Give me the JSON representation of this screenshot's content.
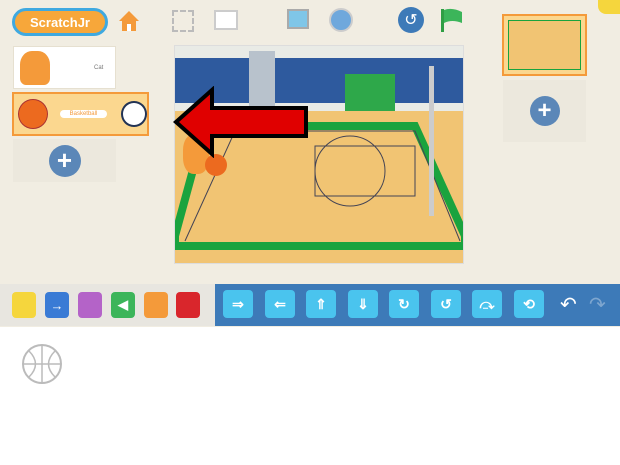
{
  "app": {
    "logo": "ScratchJr"
  },
  "sprites": [
    {
      "name": "Cat",
      "selected": false
    },
    {
      "name": "Basketball",
      "selected": true
    }
  ],
  "categories": [
    {
      "name": "triggering",
      "color": "#f5d63d"
    },
    {
      "name": "motion",
      "color": "#3a7bd5"
    },
    {
      "name": "looks",
      "color": "#b463c8"
    },
    {
      "name": "sound",
      "color": "#3cb55a"
    },
    {
      "name": "control",
      "color": "#f49a3a"
    },
    {
      "name": "end",
      "color": "#d9262c"
    }
  ],
  "blocks": [
    {
      "name": "move-right",
      "glyph": "⇒"
    },
    {
      "name": "move-left",
      "glyph": "⇐"
    },
    {
      "name": "move-up",
      "glyph": "⇑"
    },
    {
      "name": "move-down",
      "glyph": "⇓"
    },
    {
      "name": "turn-right",
      "glyph": "↻"
    },
    {
      "name": "turn-left",
      "glyph": "↺"
    },
    {
      "name": "hop",
      "glyph": "⤼"
    },
    {
      "name": "go-home",
      "glyph": "⟲"
    }
  ],
  "colors": {
    "accent": "#f7a73a",
    "blocks_bg": "#3d7ab8",
    "arrow": "#e00000"
  }
}
